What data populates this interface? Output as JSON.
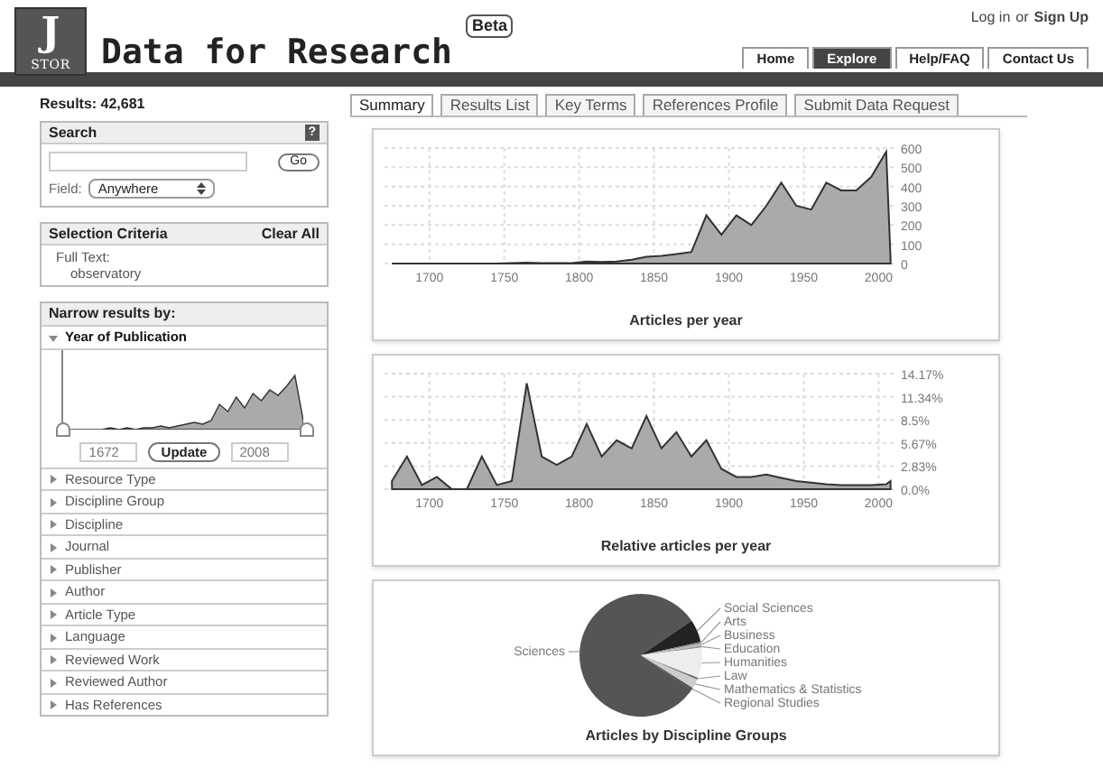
{
  "logo": {
    "letter": "J",
    "text": "STOR"
  },
  "site_title": "Data for Research",
  "badge": "Beta",
  "account": {
    "login": "Log in",
    "separator": "or",
    "signup": "Sign Up"
  },
  "nav_tabs": [
    {
      "label": "Home",
      "selected": false
    },
    {
      "label": "Explore",
      "selected": true
    },
    {
      "label": "Help/FAQ",
      "selected": false
    },
    {
      "label": "Contact Us",
      "selected": false
    }
  ],
  "results": "Results: 42,681",
  "search": {
    "title": "Search",
    "help": "?",
    "button": "Go",
    "field_label": "Field:",
    "field_value": "Anywhere"
  },
  "selection_criteria": {
    "title": "Selection Criteria",
    "clear": "Clear All",
    "label": "Full Text:",
    "value": "observatory"
  },
  "narrow": {
    "title": "Narrow results by:",
    "year_from": "1672",
    "year_to": "2008",
    "update": "Update",
    "handles": [
      {
        "level": 0
      },
      {
        "level": 1
      }
    ],
    "items": [
      {
        "label": "Year of Publication",
        "expanded": true
      },
      {
        "label": "Resource Type",
        "expanded": false
      },
      {
        "label": "Discipline Group",
        "expanded": false
      },
      {
        "label": "Discipline",
        "expanded": false
      },
      {
        "label": "Journal",
        "expanded": false
      },
      {
        "label": "Publisher",
        "expanded": false
      },
      {
        "label": "Author",
        "expanded": false
      },
      {
        "label": "Article Type",
        "expanded": false
      },
      {
        "label": "Language",
        "expanded": false
      },
      {
        "label": "Reviewed Work",
        "expanded": false
      },
      {
        "label": "Reviewed Author",
        "expanded": false
      },
      {
        "label": "Has References",
        "expanded": false
      }
    ]
  },
  "content_tabs": [
    {
      "label": "Summary",
      "selected": true
    },
    {
      "label": "Results List",
      "selected": false
    },
    {
      "label": "Key Terms",
      "selected": false
    },
    {
      "label": "References Profile",
      "selected": false
    },
    {
      "label": "Submit Data Request",
      "selected": false
    }
  ],
  "charts": [
    {
      "chart_data": {
        "type": "area",
        "title": "Articles per year",
        "x": [
          1675,
          1685,
          1695,
          1705,
          1715,
          1725,
          1735,
          1745,
          1755,
          1765,
          1775,
          1785,
          1795,
          1805,
          1815,
          1825,
          1835,
          1845,
          1855,
          1865,
          1875,
          1885,
          1895,
          1905,
          1915,
          1925,
          1935,
          1945,
          1955,
          1965,
          1975,
          1985,
          1995,
          2005,
          2008
        ],
        "values": [
          0,
          0,
          0,
          0,
          0,
          0,
          0,
          0,
          2,
          5,
          3,
          2,
          3,
          10,
          8,
          10,
          20,
          35,
          40,
          50,
          60,
          250,
          150,
          250,
          200,
          300,
          420,
          300,
          280,
          420,
          380,
          380,
          450,
          580,
          30
        ],
        "xlim": [
          1670,
          2010
        ],
        "ylim": [
          0,
          600
        ],
        "grid": true,
        "xticks": [
          1700,
          1750,
          1800,
          1850,
          1900,
          1950,
          2000
        ],
        "yticks": [
          0,
          100,
          200,
          300,
          400,
          500,
          600
        ]
      }
    },
    {
      "chart_data": {
        "type": "area",
        "title": "Relative articles per year",
        "x": [
          1675,
          1685,
          1695,
          1705,
          1715,
          1725,
          1735,
          1745,
          1755,
          1765,
          1775,
          1785,
          1795,
          1805,
          1815,
          1825,
          1835,
          1845,
          1855,
          1865,
          1875,
          1885,
          1895,
          1905,
          1915,
          1925,
          1935,
          1945,
          1955,
          1965,
          1975,
          1985,
          1995,
          2005,
          2008
        ],
        "values": [
          1,
          4,
          0.5,
          1.5,
          0,
          0,
          4,
          0.5,
          1,
          13,
          4,
          3,
          4,
          8,
          4,
          6,
          5,
          9,
          5,
          7,
          4,
          6,
          2.5,
          1.5,
          1.5,
          1.8,
          1.4,
          1,
          0.8,
          0.6,
          0.5,
          0.5,
          0.5,
          0.6,
          1
        ],
        "xlim": [
          1670,
          2010
        ],
        "ylim": [
          0,
          14.17
        ],
        "grid": true,
        "xticks": [
          1700,
          1750,
          1800,
          1850,
          1900,
          1950,
          2000
        ],
        "yticks": [
          {
            "value": 0,
            "label": "0.0%"
          },
          {
            "value": 2.83,
            "label": "2.83%"
          },
          {
            "value": 5.67,
            "label": "5.67%"
          },
          {
            "value": 8.5,
            "label": "8.5%"
          },
          {
            "value": 11.34,
            "label": "11.34%"
          },
          {
            "value": 14.17,
            "label": "14.17%"
          }
        ]
      }
    },
    {
      "chart_data": {
        "type": "pie",
        "title": "Articles by Discipline Groups",
        "categories": [
          "Sciences",
          "Social Sciences",
          "Arts",
          "Business",
          "Education",
          "Humanities",
          "Law",
          "Mathematics & Statistics",
          "Regional Studies"
        ],
        "values": [
          81,
          6,
          0.5,
          0.5,
          0.5,
          8,
          0.5,
          2.5,
          0.5
        ]
      }
    }
  ]
}
